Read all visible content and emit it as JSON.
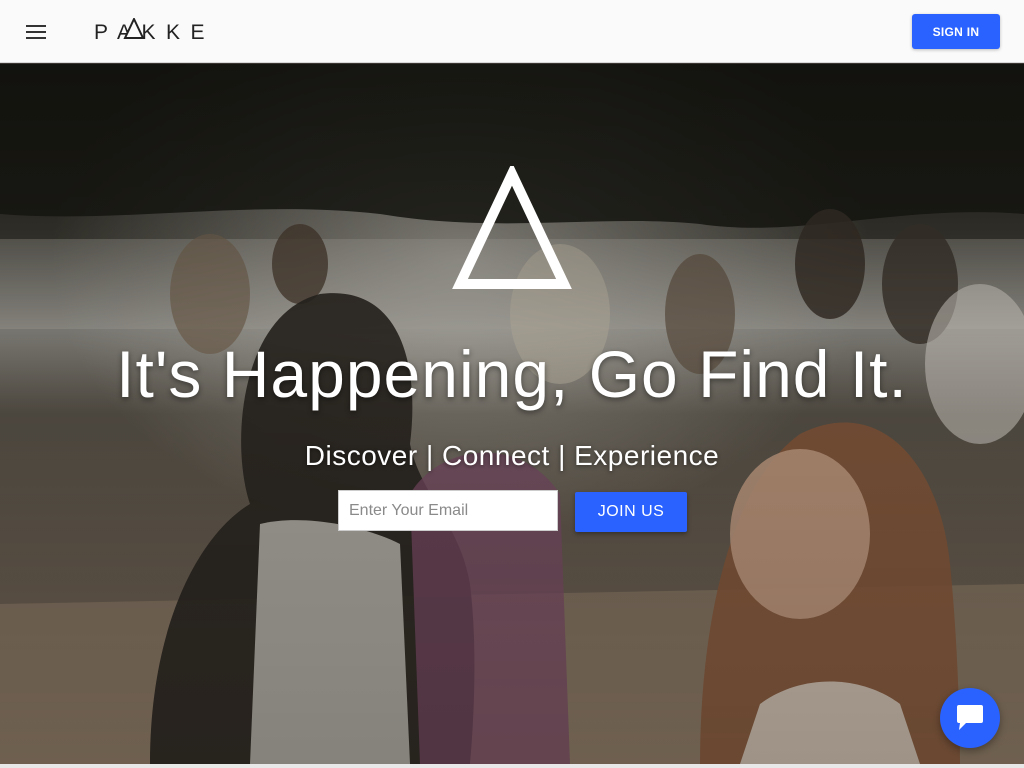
{
  "header": {
    "brand": "PAKKE",
    "sign_in_label": "SIGN IN"
  },
  "hero": {
    "headline": "It's Happening, Go Find It.",
    "tagline": "Discover | Connect | Experience",
    "email_placeholder": "Enter Your Email",
    "email_value": "",
    "join_label": "JOIN US"
  },
  "icons": {
    "menu": "hamburger-menu-icon",
    "logo_mark": "triangle-icon",
    "chat": "chat-bubble-icon"
  },
  "colors": {
    "accent": "#2962ff",
    "header_bg": "#fafafa",
    "text_on_dark": "#ffffff"
  }
}
